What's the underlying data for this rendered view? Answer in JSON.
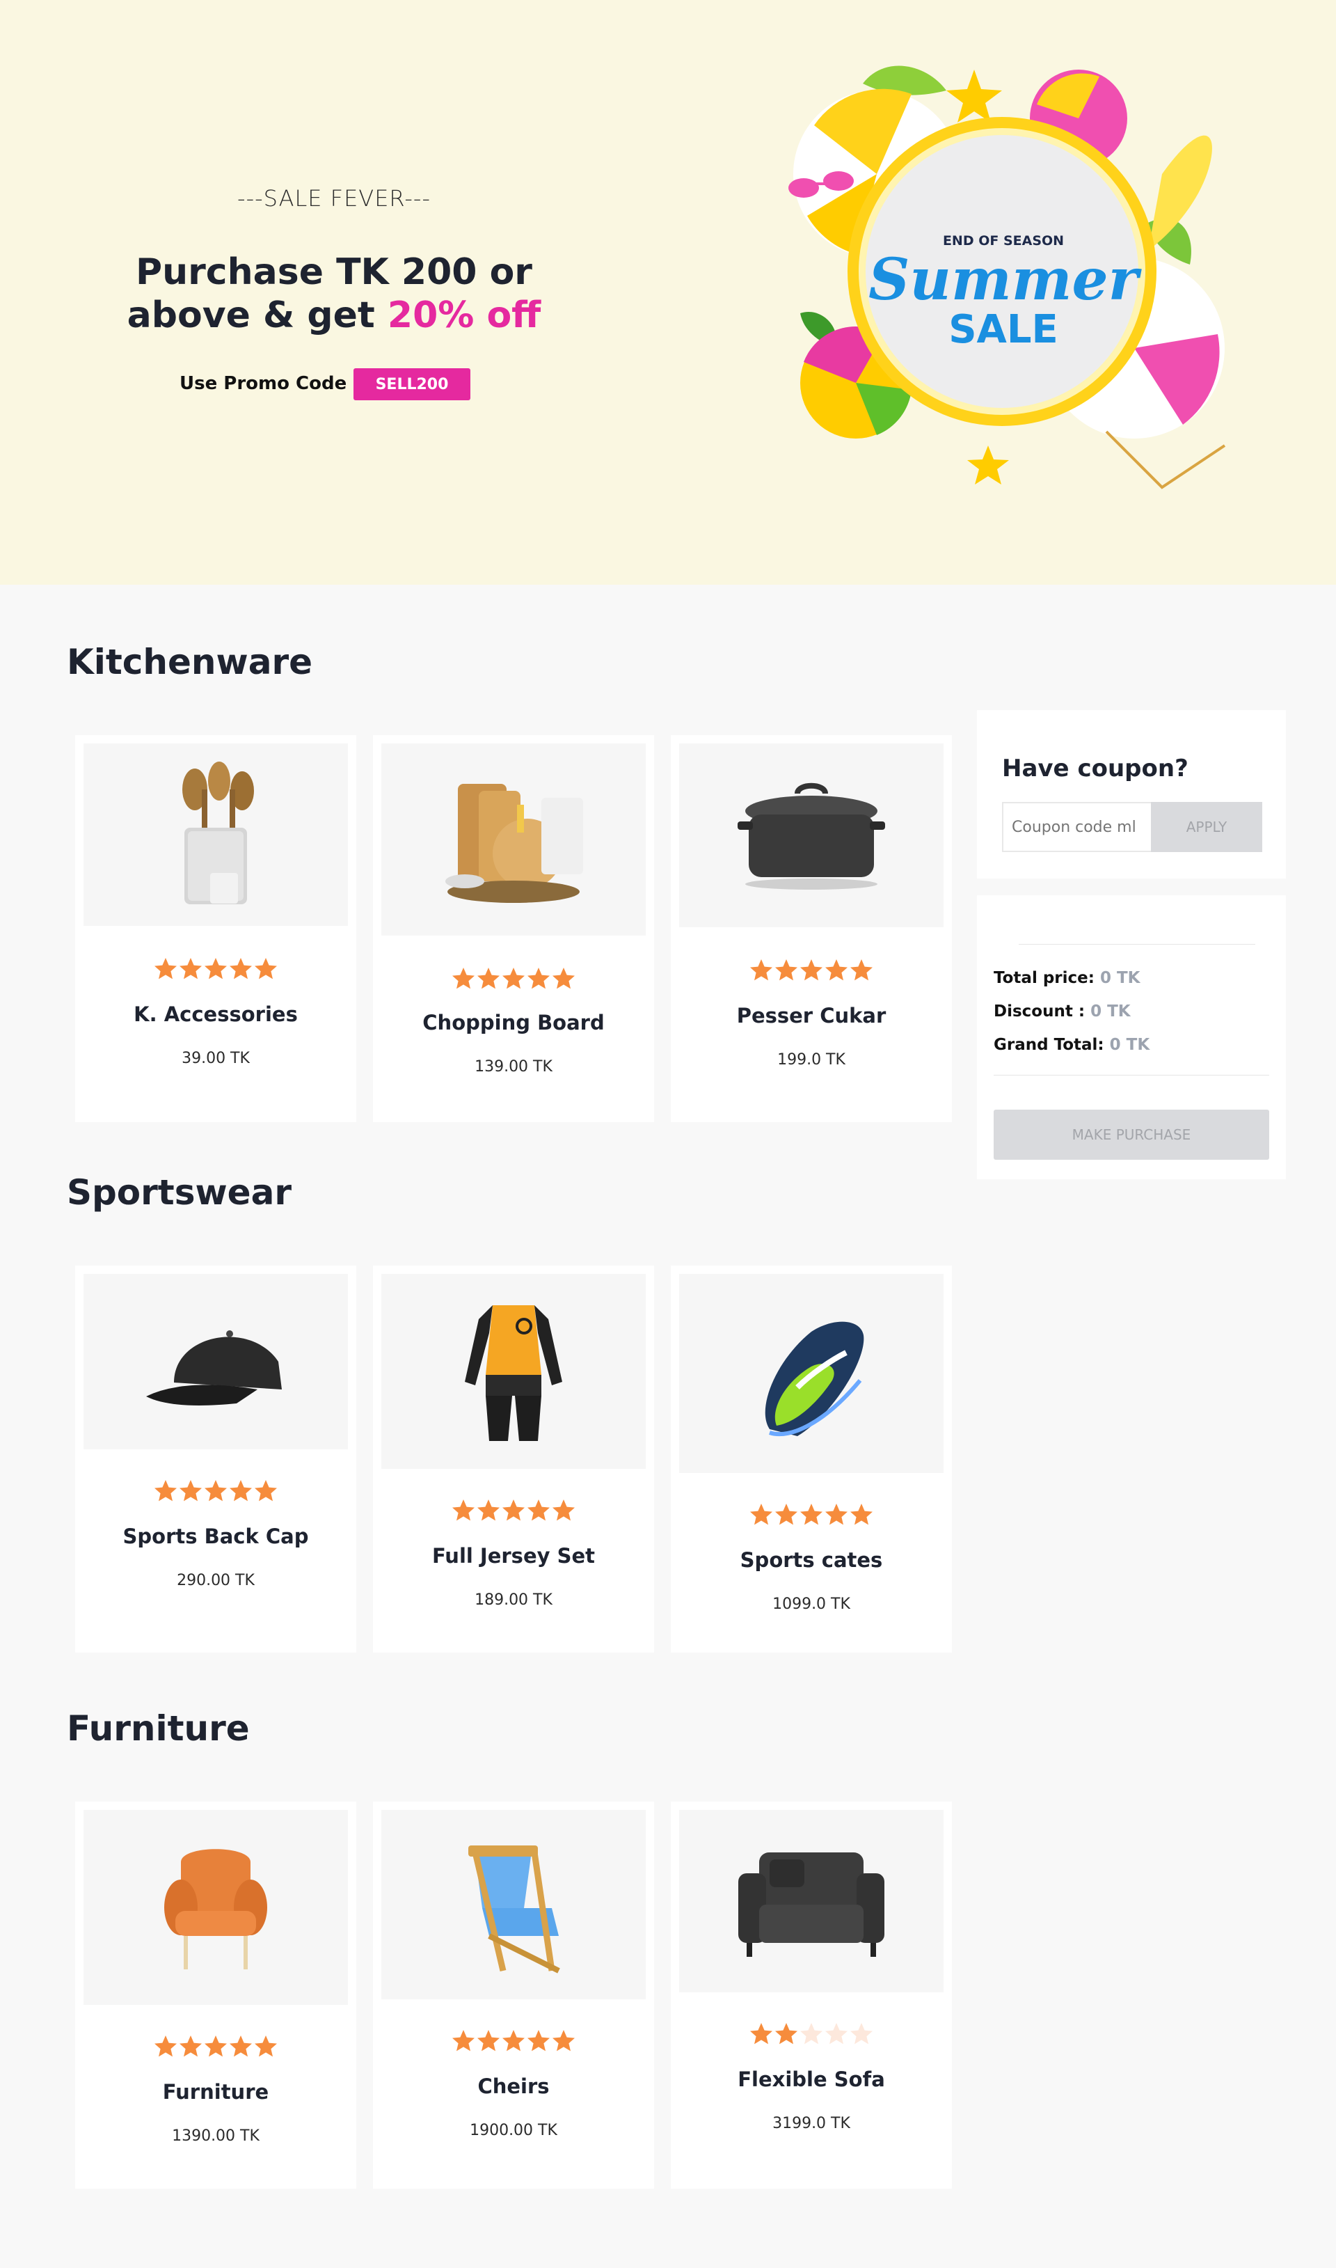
{
  "hero": {
    "tag": "---SALE FEVER---",
    "headline_line1": "Purchase TK 200 or",
    "headline_line2_prefix": "above & get ",
    "headline_highlight": "20% off",
    "promo_label": "Use Promo Code",
    "promo_code": "SELL200",
    "badge": {
      "line1": "END OF SEASON",
      "line2": "Summer",
      "line3": "SALE"
    }
  },
  "colors": {
    "accent_pink": "#e5299f",
    "star": "#f68c3c",
    "star_empty": "#fde8dc",
    "hero_bg": "#faf7e1"
  },
  "sections": [
    {
      "title": "Kitchenware",
      "products": [
        {
          "name": "K. Accessories",
          "price": "39.00 TK",
          "rating": 5,
          "icon": "utensil-holder-icon"
        },
        {
          "name": "Chopping Board",
          "price": "139.00 TK",
          "rating": 5,
          "icon": "chopping-board-icon"
        },
        {
          "name": "Pesser Cukar",
          "price": "199.0 TK",
          "rating": 5,
          "icon": "pressure-cooker-icon"
        }
      ]
    },
    {
      "title": "Sportswear",
      "products": [
        {
          "name": "Sports Back Cap",
          "price": "290.00 TK",
          "rating": 5,
          "icon": "cap-icon"
        },
        {
          "name": "Full Jersey Set",
          "price": "189.00 TK",
          "rating": 5,
          "icon": "jersey-icon"
        },
        {
          "name": "Sports cates",
          "price": "1099.0 TK",
          "rating": 5,
          "icon": "sneaker-icon"
        }
      ]
    },
    {
      "title": "Furniture",
      "products": [
        {
          "name": "Furniture",
          "price": "1390.00 TK",
          "rating": 5,
          "icon": "armchair-icon"
        },
        {
          "name": "Cheirs",
          "price": "1900.00 TK",
          "rating": 5,
          "icon": "folding-chair-icon"
        },
        {
          "name": "Flexible Sofa",
          "price": "3199.0 TK",
          "rating": 2,
          "icon": "sofa-icon"
        }
      ]
    }
  ],
  "coupon": {
    "title": "Have coupon?",
    "placeholder": "Coupon code ml",
    "apply_label": "APPLY"
  },
  "summary": {
    "total_label": "Total price: ",
    "total_value": "0 TK",
    "discount_label": "Discount : ",
    "discount_value": "0 TK",
    "grand_label": "Grand Total: ",
    "grand_value": "0 TK",
    "purchase_label": "MAKE PURCHASE"
  }
}
